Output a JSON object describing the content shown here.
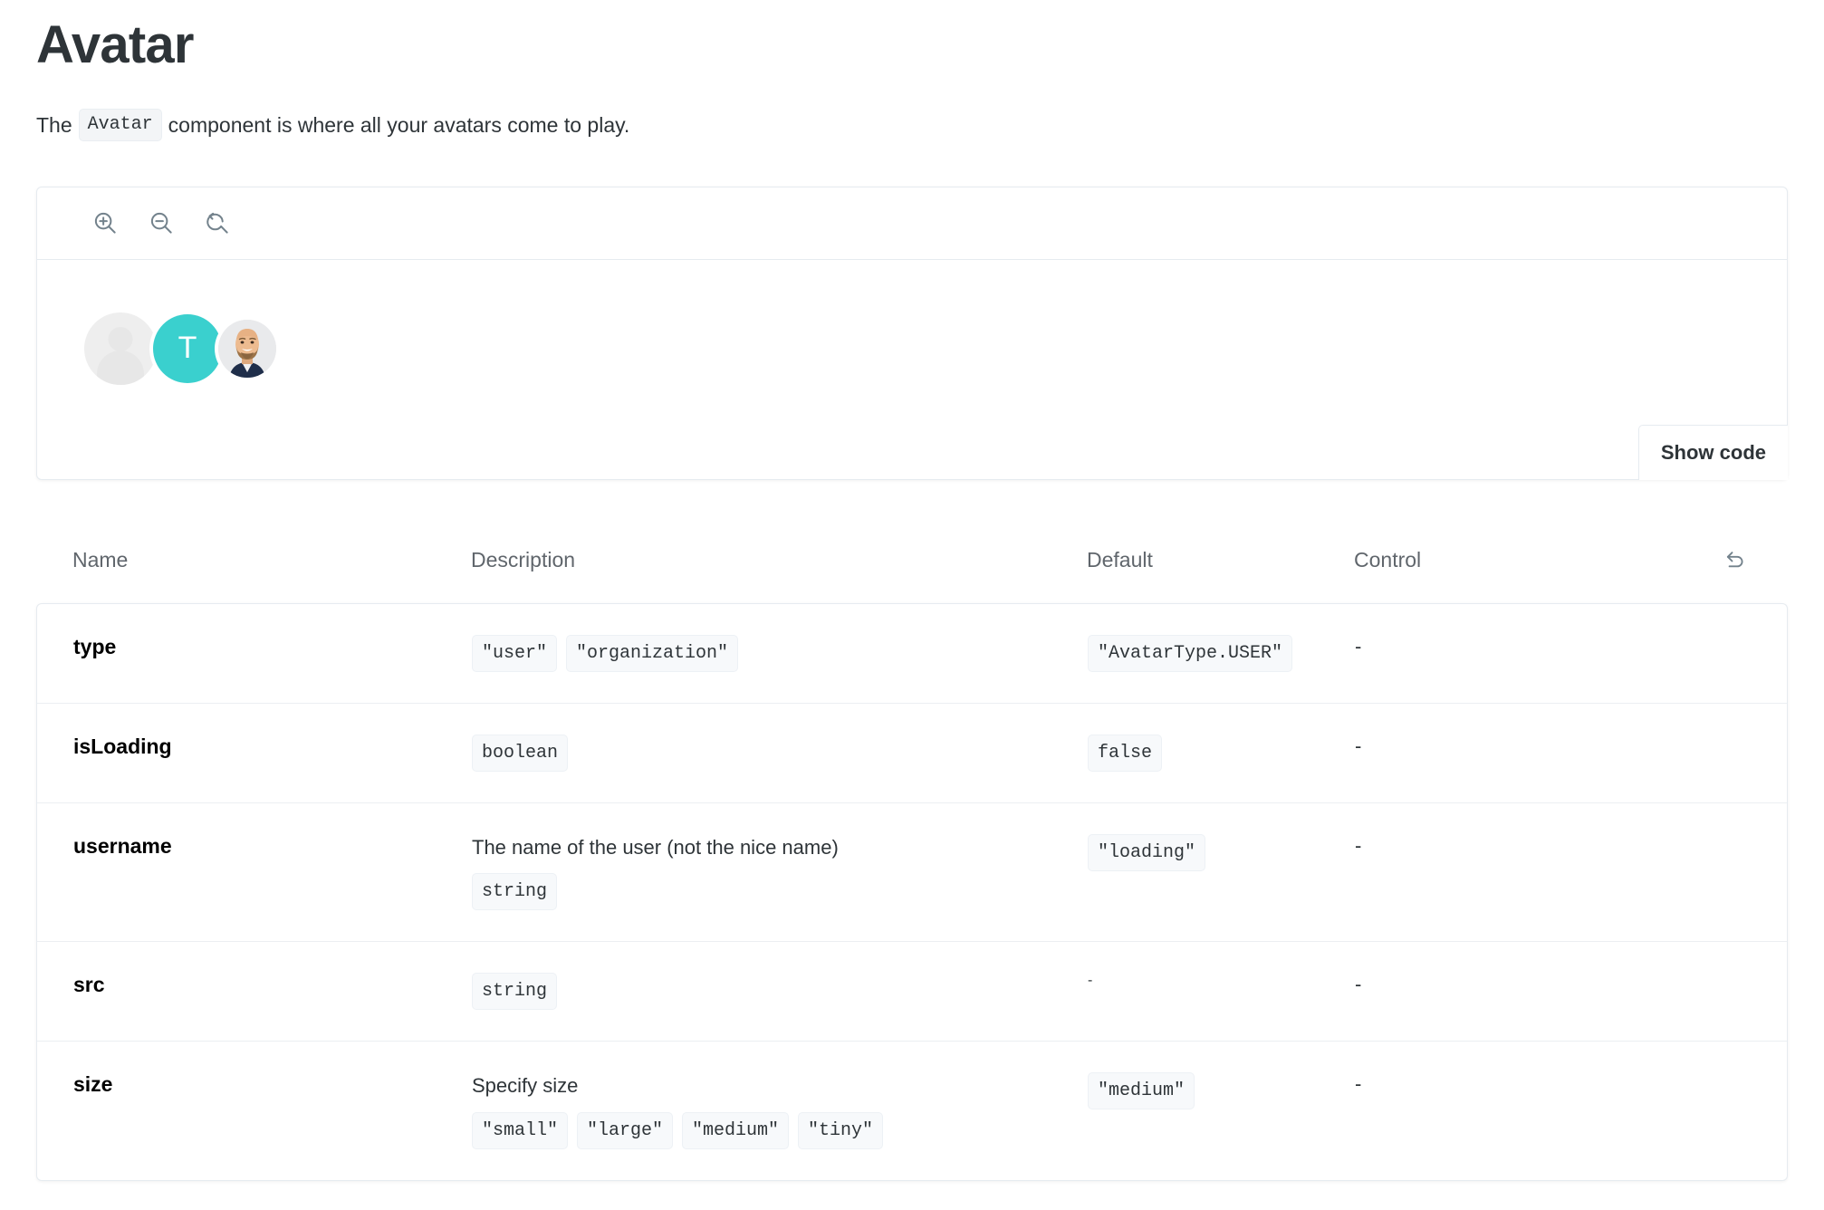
{
  "header": {
    "title": "Avatar",
    "intro_before": "The",
    "intro_code": "Avatar",
    "intro_after": "component is where all your avatars come to play."
  },
  "preview": {
    "toolbar": [
      {
        "name": "zoom-in-icon",
        "label": "Zoom in"
      },
      {
        "name": "zoom-out-icon",
        "label": "Zoom out"
      },
      {
        "name": "zoom-reset-icon",
        "label": "Reset zoom"
      }
    ],
    "avatars": [
      {
        "kind": "placeholder",
        "label": ""
      },
      {
        "kind": "initial",
        "label": "T",
        "color": "#3ad0ce"
      },
      {
        "kind": "photo",
        "label": ""
      }
    ],
    "show_code_label": "Show code"
  },
  "args_table": {
    "columns": {
      "name": "Name",
      "description": "Description",
      "default": "Default",
      "control": "Control"
    },
    "reset_icon": "undo-reset-icon",
    "rows": [
      {
        "name": "type",
        "description": "",
        "desc_chips": [
          "\"user\"",
          "\"organization\""
        ],
        "default": "\"AvatarType.USER\"",
        "default_is_chip": true,
        "control": "-"
      },
      {
        "name": "isLoading",
        "description": "",
        "desc_chips": [
          "boolean"
        ],
        "default": "false",
        "default_is_chip": true,
        "control": "-"
      },
      {
        "name": "username",
        "description": "The name of the user (not the nice name)",
        "desc_chips": [
          "string"
        ],
        "default": "\"loading\"",
        "default_is_chip": true,
        "control": "-"
      },
      {
        "name": "src",
        "description": "",
        "desc_chips": [
          "string"
        ],
        "default": "-",
        "default_is_chip": false,
        "control": "-"
      },
      {
        "name": "size",
        "description": "Specify size",
        "desc_chips": [
          "\"small\"",
          "\"large\"",
          "\"medium\"",
          "\"tiny\""
        ],
        "default": "\"medium\"",
        "default_is_chip": true,
        "control": "-"
      }
    ]
  },
  "colors": {
    "accent_teal": "#3ad0ce",
    "text": "#2e3438",
    "muted": "#60666c",
    "border": "#e6ebf0",
    "chip_bg": "#f7f9fb"
  }
}
